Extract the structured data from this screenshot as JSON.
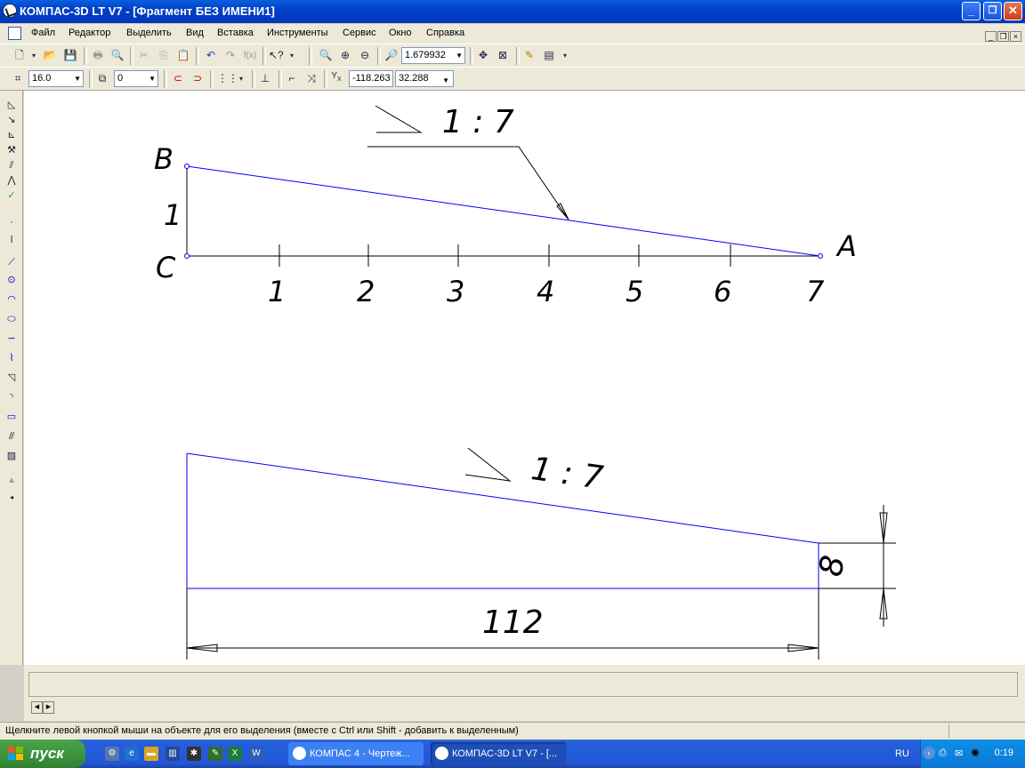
{
  "window": {
    "title": "КОМПАС-3D LT V7 - [Фрагмент БЕЗ ИМЕНИ1]",
    "minimize": "_",
    "maximize": "❐",
    "close": "✕"
  },
  "menu": {
    "items": [
      "Файл",
      "Редактор",
      "Выделить",
      "Вид",
      "Вставка",
      "Инструменты",
      "Сервис",
      "Окно",
      "Справка"
    ]
  },
  "toolbar1": {
    "zoom_value": "1.679932",
    "fx_label": "f(x)"
  },
  "toolbar2": {
    "step_value": "16.0",
    "layer_value": "0",
    "coord_x": "-118.263",
    "coord_y": "32.288",
    "coord_label": "Y",
    "coord_sub": "X"
  },
  "drawing": {
    "top_figure": {
      "slope_label": "1 : 7",
      "point_b": "B",
      "point_c": "C",
      "point_a": "A",
      "vertical_label": "1",
      "ticks": [
        "1",
        "2",
        "3",
        "4",
        "5",
        "6",
        "7"
      ]
    },
    "bottom_figure": {
      "slope_label": "1 : 7",
      "length_dim": "112",
      "height_dim": "8"
    },
    "line_color": "#0000ff"
  },
  "statusbar": {
    "hint": "Щелкните левой кнопкой мыши на объекте для его выделения (вместе с Ctrl или Shift - добавить к выделенным)"
  },
  "taskbar": {
    "start_label": "пуск",
    "tasks": [
      {
        "label": "КОМПАС 4 - Чертеж..."
      },
      {
        "label": "КОМПАС-3D LT V7 - [..."
      }
    ],
    "lang": "RU",
    "clock": "0:19"
  }
}
